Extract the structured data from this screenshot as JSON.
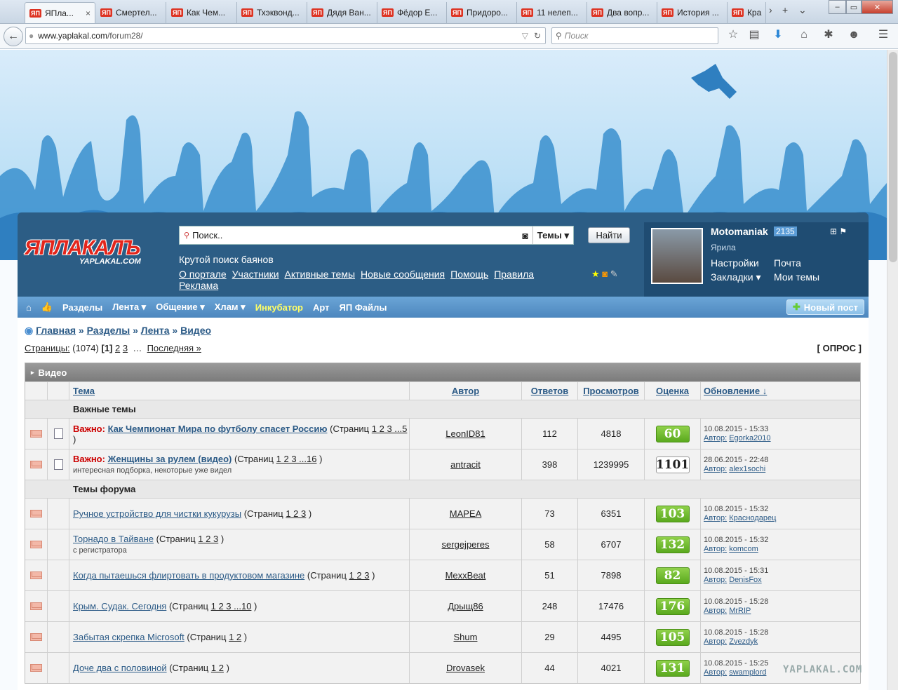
{
  "browser": {
    "tabs": [
      "ЯПла...",
      "Смертел...",
      "Как Чем...",
      "Тхэквонд...",
      "Дядя Ван...",
      "Фёдор Е...",
      "Придоро...",
      "11 нелеп...",
      "Два вопр...",
      "История ...",
      "Кра"
    ],
    "url_host": "www.yaplakal.com",
    "url_path": "/forum28/",
    "search_placeholder": "Поиск",
    "controls": {
      "close": "×",
      "add": "+",
      "more": "›",
      "list": "⌄"
    }
  },
  "site": {
    "logo_text": "ЯПЛАКАЛЪ",
    "logo_sub": "YAPLAKAL.COM",
    "search_placeholder": "Поиск..",
    "search_scope": "Темы",
    "find_label": "Найти",
    "tagline": "Крутой поиск баянов",
    "links": [
      "О портале",
      "Участники",
      "Активные темы",
      "Новые сообщения",
      "Помощь",
      "Правила",
      "Реклама"
    ]
  },
  "user": {
    "name": "Motomaniak",
    "rating": "2135",
    "rank": "Ярила",
    "links": [
      "Настройки",
      "Почта",
      "Закладки",
      "Мои темы"
    ]
  },
  "menu": {
    "items": [
      "Разделы",
      "Лента",
      "Общение",
      "Хлам",
      "Инкубатор",
      "Арт",
      "ЯП Файлы"
    ],
    "highlight_color": "#ffff66",
    "new_post": "Новый пост"
  },
  "breadcrumb": [
    "Главная",
    "Разделы",
    "Лента",
    "Видео"
  ],
  "pager": {
    "label": "Страницы:",
    "count": "(1074)",
    "current": "[1]",
    "pages": [
      "2",
      "3"
    ],
    "last": "Последняя »"
  },
  "opros": "[ ОПРОС ]",
  "table": {
    "title": "Видео",
    "headers": [
      "Тема",
      "Автор",
      "Ответов",
      "Просмотров",
      "Оценка",
      "Обновление ↓"
    ],
    "section_important": "Важные темы",
    "section_forum": "Темы форума",
    "important_label": "Важно:",
    "pages_prefix": "(Страниц",
    "author_label": "Автор:",
    "important": [
      {
        "title": "Как Чемпионат Мира по футболу спасет Россию",
        "pages": "1 2 3 ...5",
        "desc": "",
        "author": "LeonID81",
        "replies": "112",
        "views": "4818",
        "score": "60",
        "date": "10.08.2015 - 15:33",
        "last": "Egorka2010",
        "white": false
      },
      {
        "title": "Женщины за рулем (видео)",
        "pages": "1 2 3 ...16",
        "desc": "интересная подборка, некоторые уже видел",
        "author": "antracit",
        "replies": "398",
        "views": "1239995",
        "score": "1101",
        "date": "28.06.2015 - 22:48",
        "last": "alex1sochi",
        "white": true
      }
    ],
    "topics": [
      {
        "title": "Ручное устройство для чистки кукурузы",
        "pages": "1 2 3",
        "desc": "",
        "author": "MAPEA",
        "replies": "73",
        "views": "6351",
        "score": "103",
        "date": "10.08.2015 - 15:32",
        "last": "Краснодарец"
      },
      {
        "title": "Торнадо в Тайване",
        "pages": "1 2 3",
        "desc": "с регистратора",
        "author": "sergejperes",
        "replies": "58",
        "views": "6707",
        "score": "132",
        "date": "10.08.2015 - 15:32",
        "last": "komcom"
      },
      {
        "title": "Когда пытаешься флиртовать в продуктовом магазине",
        "pages": "1 2 3",
        "desc": "",
        "author": "MexxBeat",
        "replies": "51",
        "views": "7898",
        "score": "82",
        "date": "10.08.2015 - 15:31",
        "last": "DenisFox"
      },
      {
        "title": "Крым. Судак. Сегодня",
        "pages": "1 2 3 ...10",
        "desc": "",
        "author": "Дрыщ86",
        "replies": "248",
        "views": "17476",
        "score": "176",
        "date": "10.08.2015 - 15:28",
        "last": "MrRIP"
      },
      {
        "title": "Забытая скрепка Microsoft",
        "pages": "1 2",
        "desc": "",
        "author": "Shum",
        "replies": "29",
        "views": "4495",
        "score": "105",
        "date": "10.08.2015 - 15:28",
        "last": "Zvezdyk"
      },
      {
        "title": "Доче два с половиной",
        "pages": "1 2",
        "desc": "",
        "author": "Drovasek",
        "replies": "44",
        "views": "4021",
        "score": "131",
        "date": "10.08.2015 - 15:25",
        "last": "swamplord"
      }
    ]
  },
  "watermark": "YAPLAKAL.COM"
}
